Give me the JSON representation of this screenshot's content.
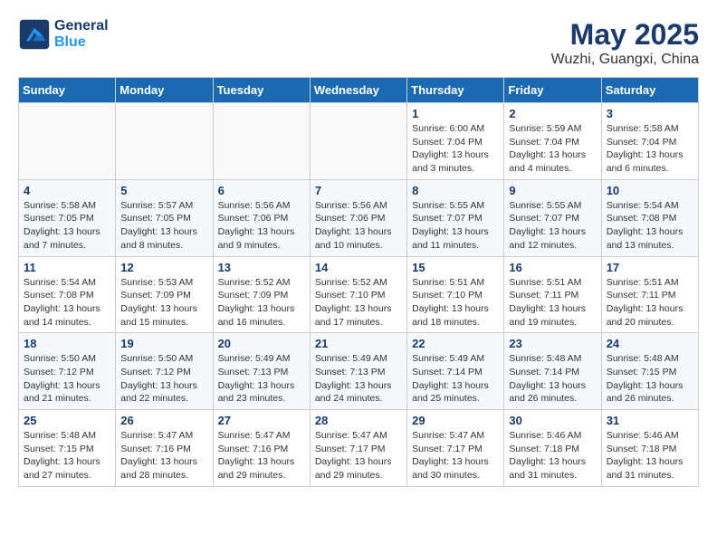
{
  "header": {
    "logo_line1": "General",
    "logo_line2": "Blue",
    "month": "May 2025",
    "location": "Wuzhi, Guangxi, China"
  },
  "weekdays": [
    "Sunday",
    "Monday",
    "Tuesday",
    "Wednesday",
    "Thursday",
    "Friday",
    "Saturday"
  ],
  "weeks": [
    [
      {
        "day": "",
        "info": ""
      },
      {
        "day": "",
        "info": ""
      },
      {
        "day": "",
        "info": ""
      },
      {
        "day": "",
        "info": ""
      },
      {
        "day": "1",
        "info": "Sunrise: 6:00 AM\nSunset: 7:04 PM\nDaylight: 13 hours\nand 3 minutes."
      },
      {
        "day": "2",
        "info": "Sunrise: 5:59 AM\nSunset: 7:04 PM\nDaylight: 13 hours\nand 4 minutes."
      },
      {
        "day": "3",
        "info": "Sunrise: 5:58 AM\nSunset: 7:04 PM\nDaylight: 13 hours\nand 6 minutes."
      }
    ],
    [
      {
        "day": "4",
        "info": "Sunrise: 5:58 AM\nSunset: 7:05 PM\nDaylight: 13 hours\nand 7 minutes."
      },
      {
        "day": "5",
        "info": "Sunrise: 5:57 AM\nSunset: 7:05 PM\nDaylight: 13 hours\nand 8 minutes."
      },
      {
        "day": "6",
        "info": "Sunrise: 5:56 AM\nSunset: 7:06 PM\nDaylight: 13 hours\nand 9 minutes."
      },
      {
        "day": "7",
        "info": "Sunrise: 5:56 AM\nSunset: 7:06 PM\nDaylight: 13 hours\nand 10 minutes."
      },
      {
        "day": "8",
        "info": "Sunrise: 5:55 AM\nSunset: 7:07 PM\nDaylight: 13 hours\nand 11 minutes."
      },
      {
        "day": "9",
        "info": "Sunrise: 5:55 AM\nSunset: 7:07 PM\nDaylight: 13 hours\nand 12 minutes."
      },
      {
        "day": "10",
        "info": "Sunrise: 5:54 AM\nSunset: 7:08 PM\nDaylight: 13 hours\nand 13 minutes."
      }
    ],
    [
      {
        "day": "11",
        "info": "Sunrise: 5:54 AM\nSunset: 7:08 PM\nDaylight: 13 hours\nand 14 minutes."
      },
      {
        "day": "12",
        "info": "Sunrise: 5:53 AM\nSunset: 7:09 PM\nDaylight: 13 hours\nand 15 minutes."
      },
      {
        "day": "13",
        "info": "Sunrise: 5:52 AM\nSunset: 7:09 PM\nDaylight: 13 hours\nand 16 minutes."
      },
      {
        "day": "14",
        "info": "Sunrise: 5:52 AM\nSunset: 7:10 PM\nDaylight: 13 hours\nand 17 minutes."
      },
      {
        "day": "15",
        "info": "Sunrise: 5:51 AM\nSunset: 7:10 PM\nDaylight: 13 hours\nand 18 minutes."
      },
      {
        "day": "16",
        "info": "Sunrise: 5:51 AM\nSunset: 7:11 PM\nDaylight: 13 hours\nand 19 minutes."
      },
      {
        "day": "17",
        "info": "Sunrise: 5:51 AM\nSunset: 7:11 PM\nDaylight: 13 hours\nand 20 minutes."
      }
    ],
    [
      {
        "day": "18",
        "info": "Sunrise: 5:50 AM\nSunset: 7:12 PM\nDaylight: 13 hours\nand 21 minutes."
      },
      {
        "day": "19",
        "info": "Sunrise: 5:50 AM\nSunset: 7:12 PM\nDaylight: 13 hours\nand 22 minutes."
      },
      {
        "day": "20",
        "info": "Sunrise: 5:49 AM\nSunset: 7:13 PM\nDaylight: 13 hours\nand 23 minutes."
      },
      {
        "day": "21",
        "info": "Sunrise: 5:49 AM\nSunset: 7:13 PM\nDaylight: 13 hours\nand 24 minutes."
      },
      {
        "day": "22",
        "info": "Sunrise: 5:49 AM\nSunset: 7:14 PM\nDaylight: 13 hours\nand 25 minutes."
      },
      {
        "day": "23",
        "info": "Sunrise: 5:48 AM\nSunset: 7:14 PM\nDaylight: 13 hours\nand 26 minutes."
      },
      {
        "day": "24",
        "info": "Sunrise: 5:48 AM\nSunset: 7:15 PM\nDaylight: 13 hours\nand 26 minutes."
      }
    ],
    [
      {
        "day": "25",
        "info": "Sunrise: 5:48 AM\nSunset: 7:15 PM\nDaylight: 13 hours\nand 27 minutes."
      },
      {
        "day": "26",
        "info": "Sunrise: 5:47 AM\nSunset: 7:16 PM\nDaylight: 13 hours\nand 28 minutes."
      },
      {
        "day": "27",
        "info": "Sunrise: 5:47 AM\nSunset: 7:16 PM\nDaylight: 13 hours\nand 29 minutes."
      },
      {
        "day": "28",
        "info": "Sunrise: 5:47 AM\nSunset: 7:17 PM\nDaylight: 13 hours\nand 29 minutes."
      },
      {
        "day": "29",
        "info": "Sunrise: 5:47 AM\nSunset: 7:17 PM\nDaylight: 13 hours\nand 30 minutes."
      },
      {
        "day": "30",
        "info": "Sunrise: 5:46 AM\nSunset: 7:18 PM\nDaylight: 13 hours\nand 31 minutes."
      },
      {
        "day": "31",
        "info": "Sunrise: 5:46 AM\nSunset: 7:18 PM\nDaylight: 13 hours\nand 31 minutes."
      }
    ]
  ]
}
